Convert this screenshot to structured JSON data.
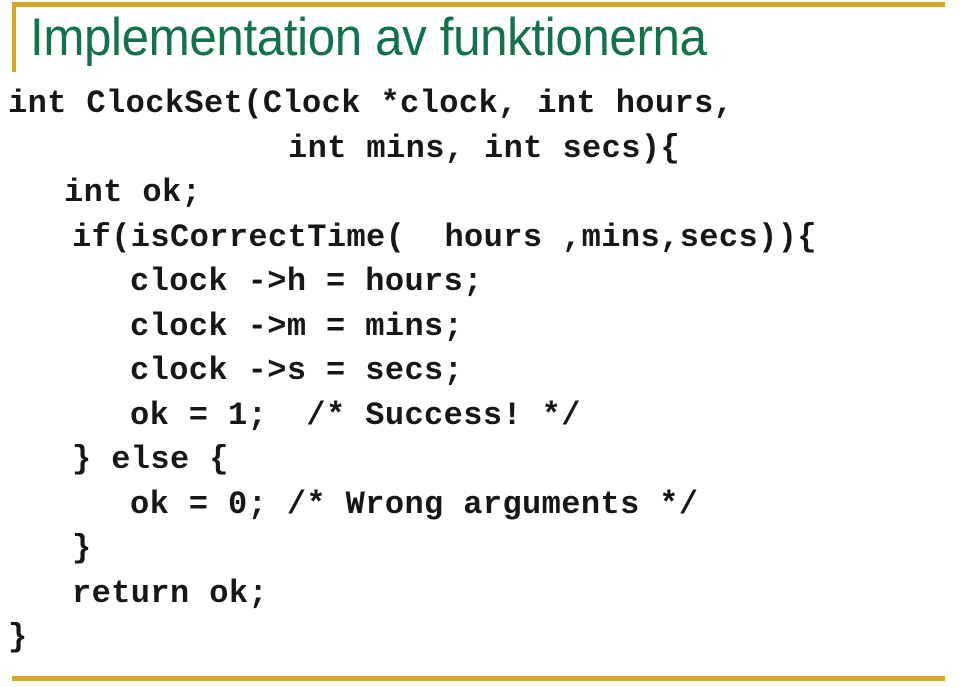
{
  "slide": {
    "title": "Implementation av funktionerna",
    "title_color": "#14714A",
    "accent_color": "#D3A82A",
    "code_color": "#17171a",
    "code": {
      "lines": [
        {
          "indent": "i0",
          "text": "int ClockSet(Clock *clock, int hours,"
        },
        {
          "indent": "i4",
          "text": "int mins, int secs){"
        },
        {
          "indent": "i1",
          "text": "int ok;"
        },
        {
          "indent": "i6",
          "text": "if(isCorrectTime(  hours ,mins,secs)){"
        },
        {
          "indent": "i3",
          "text": "clock ->h = hours;"
        },
        {
          "indent": "i3",
          "text": "clock ->m = mins;"
        },
        {
          "indent": "i3",
          "text": "clock ->s = secs;"
        },
        {
          "indent": "i3",
          "text": "ok = 1;  /* Success! */"
        },
        {
          "indent": "i6",
          "text": "} else {"
        },
        {
          "indent": "i3",
          "text": "ok = 0; /* Wrong arguments */"
        },
        {
          "indent": "i6",
          "text": "}"
        },
        {
          "indent": "i6",
          "text": "return ok;"
        },
        {
          "indent": "i5",
          "text": "}"
        }
      ]
    }
  }
}
